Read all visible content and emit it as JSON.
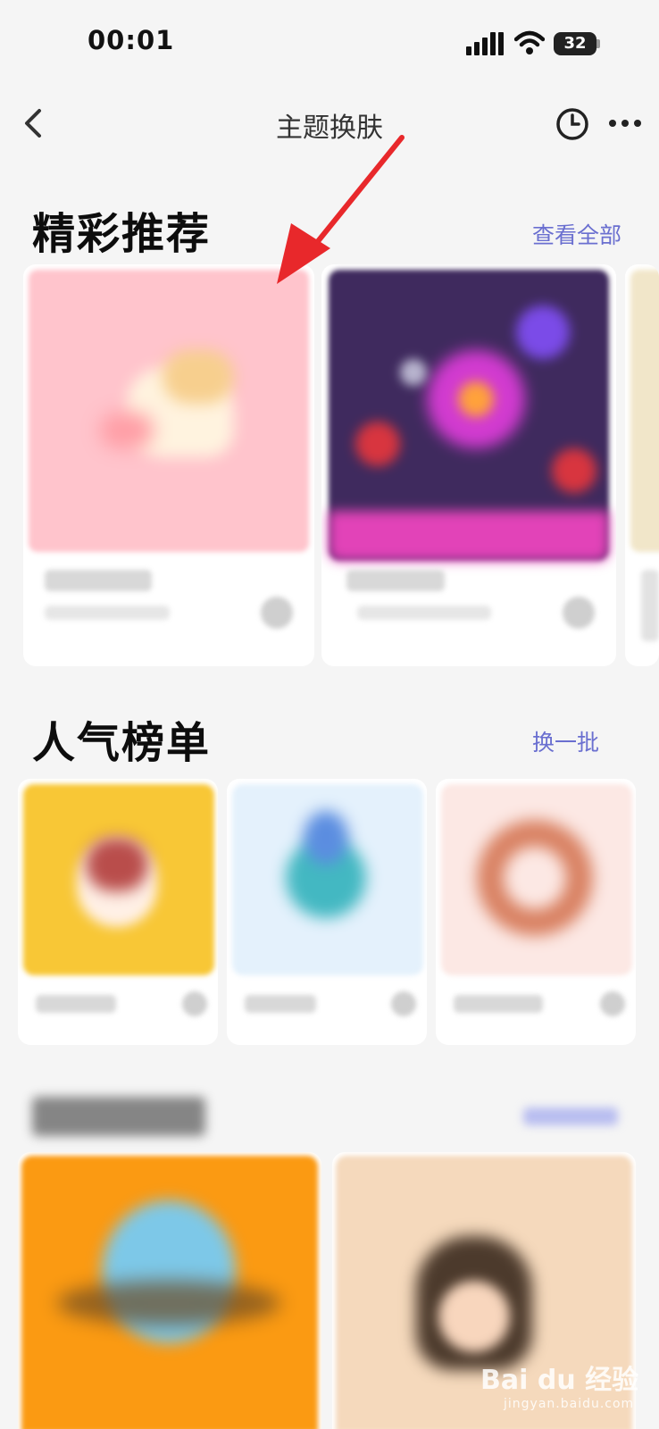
{
  "status_bar": {
    "time": "00:01",
    "battery": "32"
  },
  "nav": {
    "title": "主题换肤",
    "back_icon": "back-arrow-icon",
    "history_icon": "clock-icon",
    "more_icon": "more-dots-icon"
  },
  "featured": {
    "title": "精彩推荐",
    "link": "查看全部"
  },
  "popular": {
    "title": "人气榜单",
    "link": "换一批"
  },
  "watermark": {
    "brand": "Bai du 经验",
    "url": "jingyan.baidu.com"
  },
  "colors": {
    "accent": "#6a6fd0",
    "annotation": "#e8282b"
  }
}
